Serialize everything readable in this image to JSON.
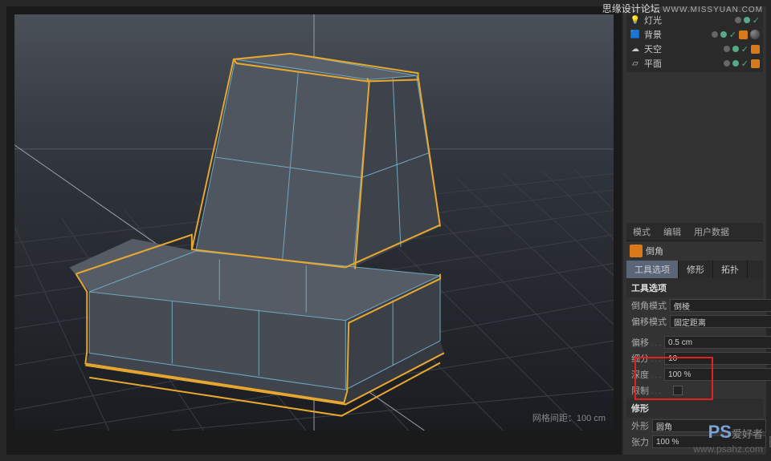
{
  "watermark_top": {
    "site": "思缘设计论坛",
    "url": "WWW.MISSYUAN.COM"
  },
  "watermark_bottom": {
    "logo": "PS",
    "cn": "爱好者",
    "url": "www.psahz.com"
  },
  "viewport": {
    "grid_info_label": "网格间距：",
    "grid_info_value": "100 cm"
  },
  "objects": [
    {
      "icon": "light",
      "name": "灯光"
    },
    {
      "icon": "bg",
      "name": "背景"
    },
    {
      "icon": "sky",
      "name": "天空"
    },
    {
      "icon": "plane",
      "name": "平面"
    }
  ],
  "attr_main_tabs": {
    "mode": "模式",
    "edit": "编辑",
    "user_data": "用户数据"
  },
  "tool_name": "倒角",
  "sub_tabs": {
    "tool_options": "工具选项",
    "modifier": "修形",
    "topology": "拓扑"
  },
  "sections": {
    "tool_options": "工具选项",
    "modifier": "修形"
  },
  "props": {
    "bevel_mode": {
      "label": "倒角模式",
      "value": "倒棱"
    },
    "offset_mode": {
      "label": "偏移模式",
      "value": "固定距离"
    },
    "offset": {
      "label": "偏移",
      "value": "0.5 cm"
    },
    "subdivision": {
      "label": "细分",
      "value": "10"
    },
    "depth": {
      "label": "深度",
      "value": "100 %"
    },
    "limit": {
      "label": "限制"
    },
    "shape": {
      "label": "外形",
      "value": "圆角"
    },
    "tension": {
      "label": "张力",
      "value": "100 %"
    }
  }
}
